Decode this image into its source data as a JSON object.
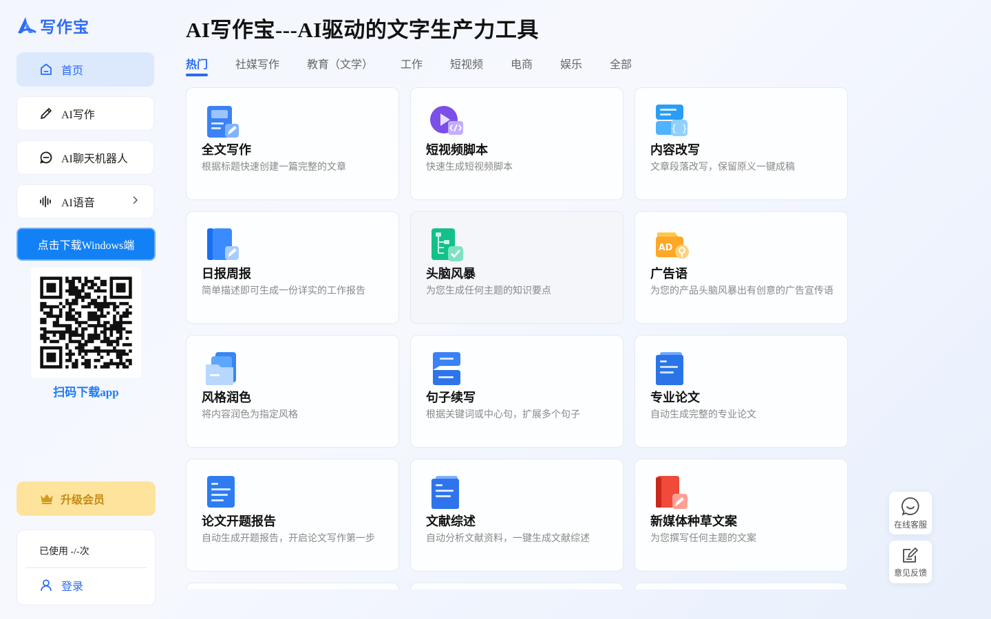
{
  "brand": {
    "name": "写作宝",
    "color": "#2f6bf5"
  },
  "sidebar": {
    "items": [
      {
        "label": "首页",
        "icon": "home-icon",
        "active": true
      },
      {
        "label": "AI写作",
        "icon": "pencil-icon"
      },
      {
        "label": "AI聊天机器人",
        "icon": "chat-icon"
      },
      {
        "label": "AI语音",
        "icon": "soundwave-icon",
        "has_submenu": true
      }
    ],
    "download_label": "点击下载Windows端",
    "qr_caption": "扫码下载app",
    "vip_label": "升级会员",
    "usage_text": "已使用 -/-次",
    "login_label": "登录"
  },
  "main": {
    "title": "AI写作宝---AI驱动的文字生产力工具",
    "tabs": [
      {
        "label": "热门",
        "active": true
      },
      {
        "label": "社媒写作"
      },
      {
        "label": "教育（文学）"
      },
      {
        "label": "工作"
      },
      {
        "label": "短视频"
      },
      {
        "label": "电商"
      },
      {
        "label": "娱乐"
      },
      {
        "label": "全部"
      }
    ],
    "cards": [
      {
        "title": "全文写作",
        "desc": "根据标题快速创建一篇完整的文章",
        "icon": "document-edit-icon"
      },
      {
        "title": "短视频脚本",
        "desc": "快速生成短视频脚本",
        "icon": "video-script-icon"
      },
      {
        "title": "内容改写",
        "desc": "文章段落改写，保留原义一键成稿",
        "icon": "rewrite-icon"
      },
      {
        "title": "日报周报",
        "desc": "简单描述即可生成一份详实的工作报告",
        "icon": "report-book-icon"
      },
      {
        "title": "头脑风暴",
        "desc": "为您生成任何主题的知识要点",
        "icon": "mindmap-icon"
      },
      {
        "title": "广告语",
        "desc": "为您的产品头脑风暴出有创意的广告宣传语",
        "icon": "ad-icon"
      },
      {
        "title": "风格润色",
        "desc": "将内容润色为指定风格",
        "icon": "folder-style-icon"
      },
      {
        "title": "句子续写",
        "desc": "根据关键词或中心句，扩展多个句子",
        "icon": "sentence-icon"
      },
      {
        "title": "专业论文",
        "desc": "自动生成完整的专业论文",
        "icon": "paper-icon"
      },
      {
        "title": "论文开题报告",
        "desc": "自动生成开题报告，开启论文写作第一步",
        "icon": "proposal-icon"
      },
      {
        "title": "文献综述",
        "desc": "自动分析文献资料，一键生成文献综述",
        "icon": "literature-icon"
      },
      {
        "title": "新媒体种草文案",
        "desc": "为您撰写任何主题的文案",
        "icon": "red-book-icon"
      }
    ]
  },
  "floating": {
    "service_label": "在线客服",
    "feedback_label": "意见反馈"
  }
}
